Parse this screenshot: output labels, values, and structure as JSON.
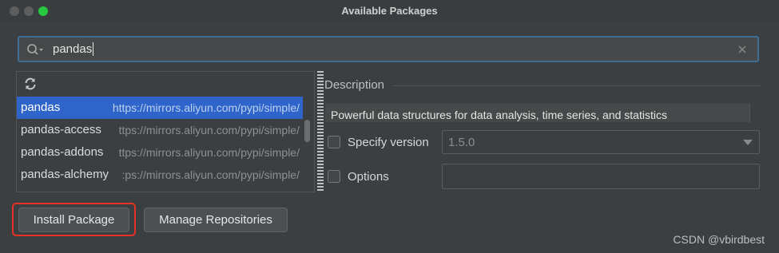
{
  "window": {
    "title": "Available Packages"
  },
  "search": {
    "value": "pandas"
  },
  "packages": [
    {
      "name": "pandas",
      "url": "https://mirrors.aliyun.com/pypi/simple/",
      "selected": true
    },
    {
      "name": "pandas-access",
      "url": "ttps://mirrors.aliyun.com/pypi/simple/",
      "selected": false
    },
    {
      "name": "pandas-addons",
      "url": "ttps://mirrors.aliyun.com/pypi/simple/",
      "selected": false
    },
    {
      "name": "pandas-alchemy",
      "url": ":ps://mirrors.aliyun.com/pypi/simple/",
      "selected": false
    }
  ],
  "details": {
    "description_label": "Description",
    "description_text": "Powerful data structures for data analysis, time series, and statistics",
    "specify_version_label": "Specify version",
    "version_value": "1.5.0",
    "options_label": "Options"
  },
  "buttons": {
    "install": "Install Package",
    "manage": "Manage Repositories"
  },
  "watermark": "CSDN @vbirdbest",
  "colors": {
    "selection": "#2f65ca",
    "focus_border": "#3e6d96",
    "highlight_box": "#e53224"
  }
}
